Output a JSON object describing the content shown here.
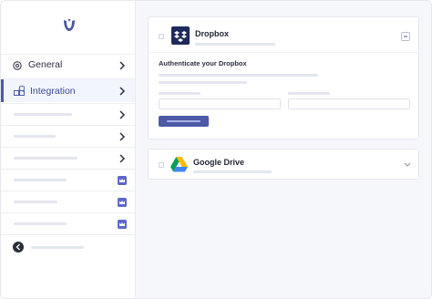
{
  "sidebar": {
    "items": [
      {
        "label": "General",
        "icon": "gear-icon"
      },
      {
        "label": "Integration",
        "icon": "integration-icon"
      }
    ],
    "premium_icon": "crown-icon",
    "accent": "#4a5aa8"
  },
  "integrations": [
    {
      "name": "Dropbox",
      "icon": "dropbox-icon",
      "expanded": true,
      "section_label": "Authenticate your Dropbox"
    },
    {
      "name": "Google Drive",
      "icon": "google-drive-icon",
      "expanded": false
    }
  ],
  "colors": {
    "primary": "#4c59a6",
    "premium": "#5b67c9",
    "background": "#f6f7fa"
  }
}
